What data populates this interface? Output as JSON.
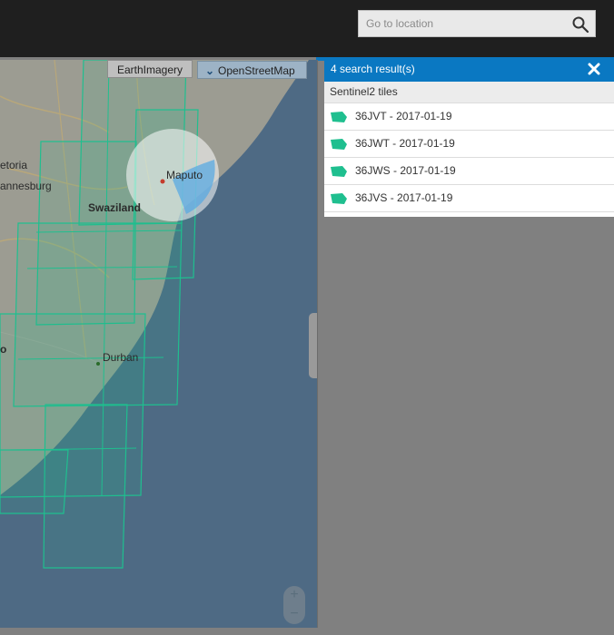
{
  "search": {
    "placeholder": "Go to location"
  },
  "layers": {
    "earth_label": "EarthImagery",
    "osm_label": "OpenStreetMap"
  },
  "map_labels": {
    "pretoria": "etoria",
    "johannesburg": "annesburg",
    "swaziland": "Swaziland",
    "maputo": "Maputo",
    "durban": "Durban",
    "lesotho": "o"
  },
  "results": {
    "header": "4 search result(s)",
    "subheader": "Sentinel2 tiles",
    "items": [
      {
        "label": "36JVT - 2017-01-19"
      },
      {
        "label": "36JWT - 2017-01-19"
      },
      {
        "label": "36JWS - 2017-01-19"
      },
      {
        "label": "36JVS - 2017-01-19"
      }
    ]
  },
  "zoom": {
    "in_label": "+",
    "out_label": "−"
  },
  "colors": {
    "accent": "#0a78c2",
    "tile_green": "#1fbf8f",
    "topbar": "#1f1f1f"
  }
}
